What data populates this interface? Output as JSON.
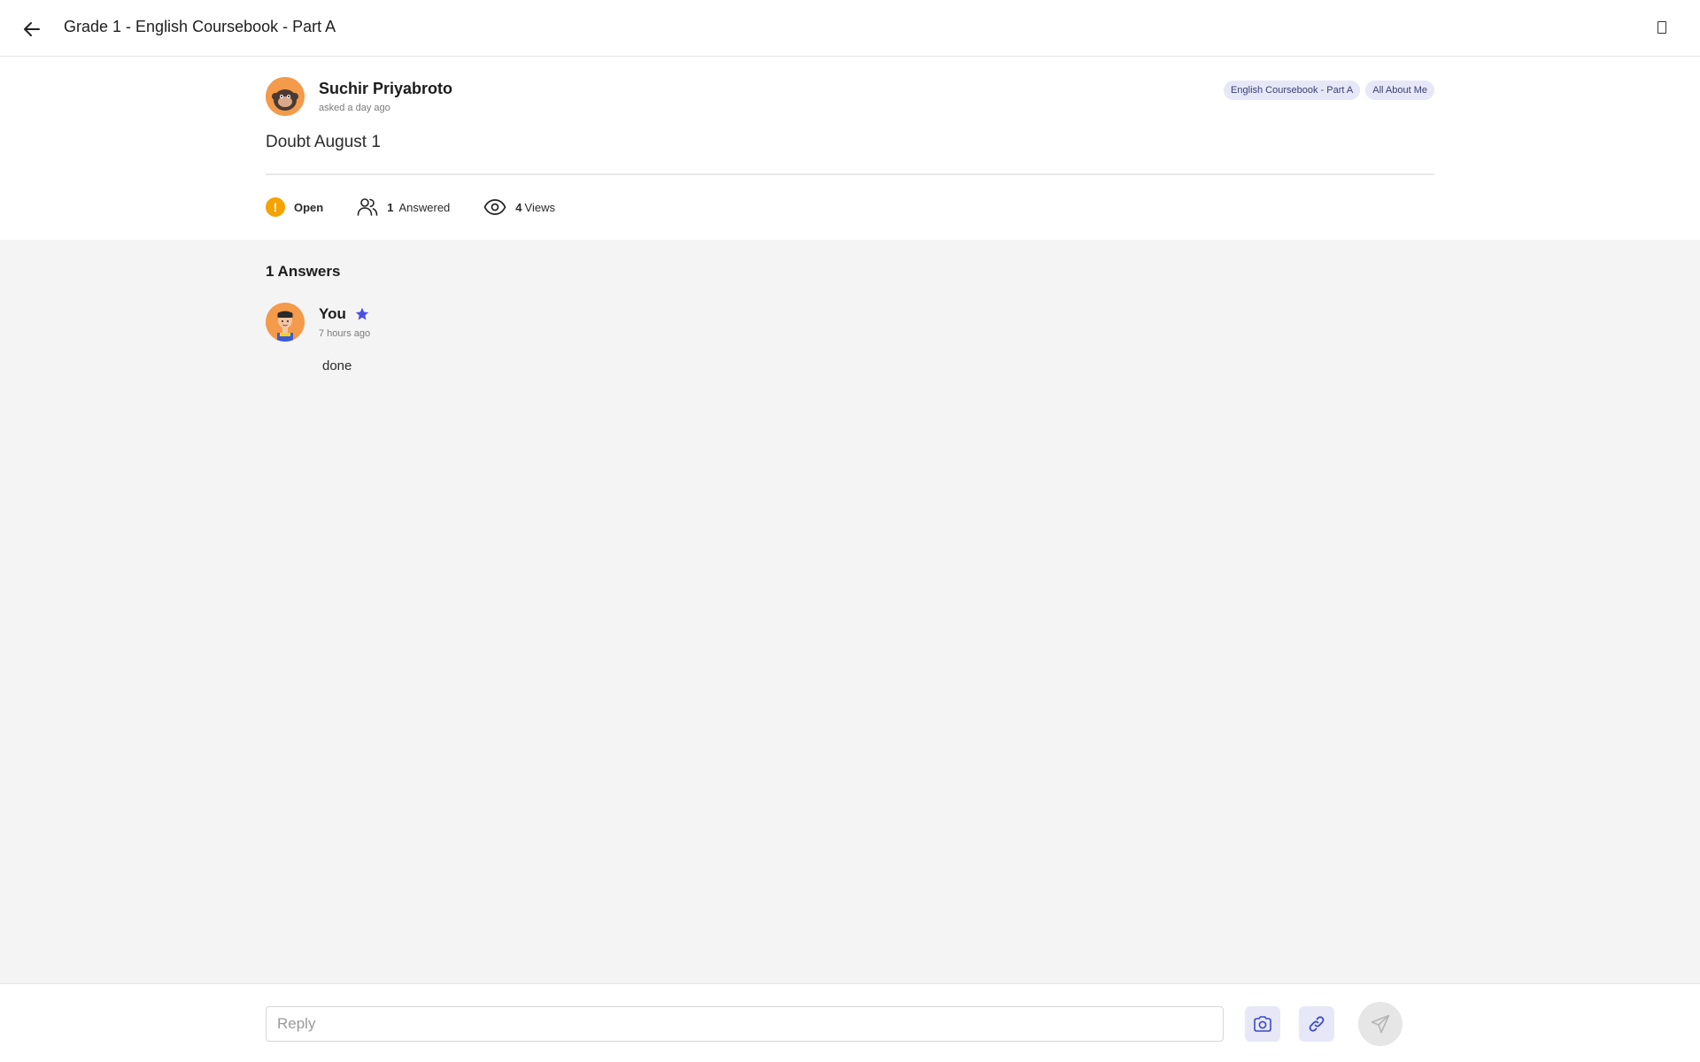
{
  "header": {
    "title": "Grade 1 - English Coursebook - Part A",
    "back_icon": "arrow-left-icon",
    "menu_icon": "square-outline-icon"
  },
  "question": {
    "author": "Suchir Priyabroto",
    "asked": "asked a day ago",
    "tags": [
      "English Coursebook - Part A",
      "All About Me"
    ],
    "title": "Doubt August 1",
    "stats": {
      "status": "Open",
      "status_color": "#f5a300",
      "answered_count": "1",
      "answered_label": "Answered",
      "views_count": "4",
      "views_label": "Views"
    }
  },
  "answers": {
    "heading": "1 Answers",
    "items": [
      {
        "author": "You",
        "time": "7 hours ago",
        "body": "done",
        "star_color": "#4a4de6"
      }
    ]
  },
  "reply": {
    "placeholder": "Reply",
    "camera_icon": "camera-icon",
    "link_icon": "link-icon",
    "send_icon": "send-icon"
  },
  "colors": {
    "accent_light": "#e6e8f8",
    "accent": "#3c47c6",
    "avatar_bg": "#f39a4b"
  }
}
